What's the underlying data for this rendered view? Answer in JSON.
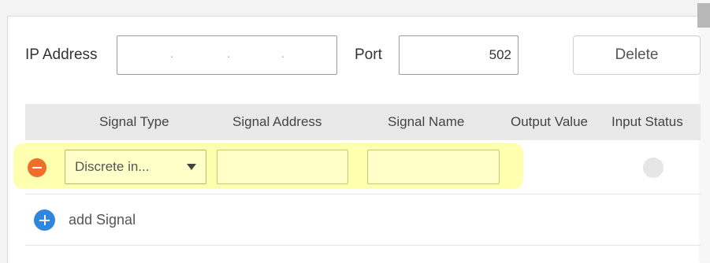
{
  "connection": {
    "ip_label": "IP Address",
    "ip_separators": [
      ".",
      ".",
      "."
    ],
    "port_label": "Port",
    "port_value": "502",
    "delete_label": "Delete"
  },
  "table": {
    "headers": [
      "Signal Type",
      "Signal Address",
      "Signal Name",
      "Output Value",
      "Input Status"
    ]
  },
  "signal_row": {
    "signal_type": "Discrete in...",
    "signal_address": "",
    "signal_name": "",
    "output_value": ""
  },
  "actions": {
    "add_signal_label": "add Signal"
  },
  "colors": {
    "remove_button": "#f16d2b",
    "add_button": "#2f86e0",
    "row_highlight": "#ffffb0",
    "field_fill": "#ffffc8",
    "header_background": "#e9e9e9"
  }
}
